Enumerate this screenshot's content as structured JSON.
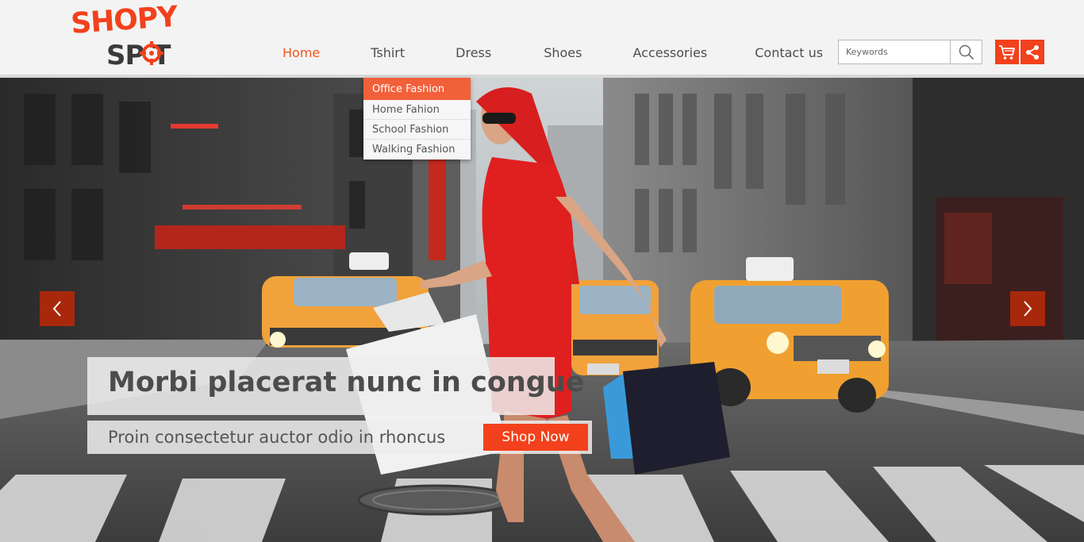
{
  "brand": {
    "logo_top": "SHOPY",
    "logo_bottom": "SP T",
    "accent_color": "#f2411c"
  },
  "nav": {
    "items": [
      {
        "label": "Home",
        "active": true
      },
      {
        "label": "Tshirt"
      },
      {
        "label": "Dress"
      },
      {
        "label": "Shoes"
      },
      {
        "label": "Accessories"
      },
      {
        "label": "Contact us"
      }
    ]
  },
  "search": {
    "placeholder": "Keywords",
    "icon": "search-icon"
  },
  "header_actions": {
    "cart_icon": "cart-icon",
    "share_icon": "share-icon"
  },
  "dropdown": {
    "items": [
      {
        "label": "Office Fashion",
        "active": true
      },
      {
        "label": "Home Fahion"
      },
      {
        "label": "School Fashion"
      },
      {
        "label": "Walking Fashion"
      }
    ]
  },
  "hero": {
    "title": "Morbi placerat nunc in congue",
    "subtitle": "Proin consectetur auctor odio in rhoncus",
    "cta_label": "Shop Now",
    "prev_icon": "chevron-left-icon",
    "next_icon": "chevron-right-icon",
    "image": "woman in red dress crossing city street with shopping bags and taxis"
  }
}
